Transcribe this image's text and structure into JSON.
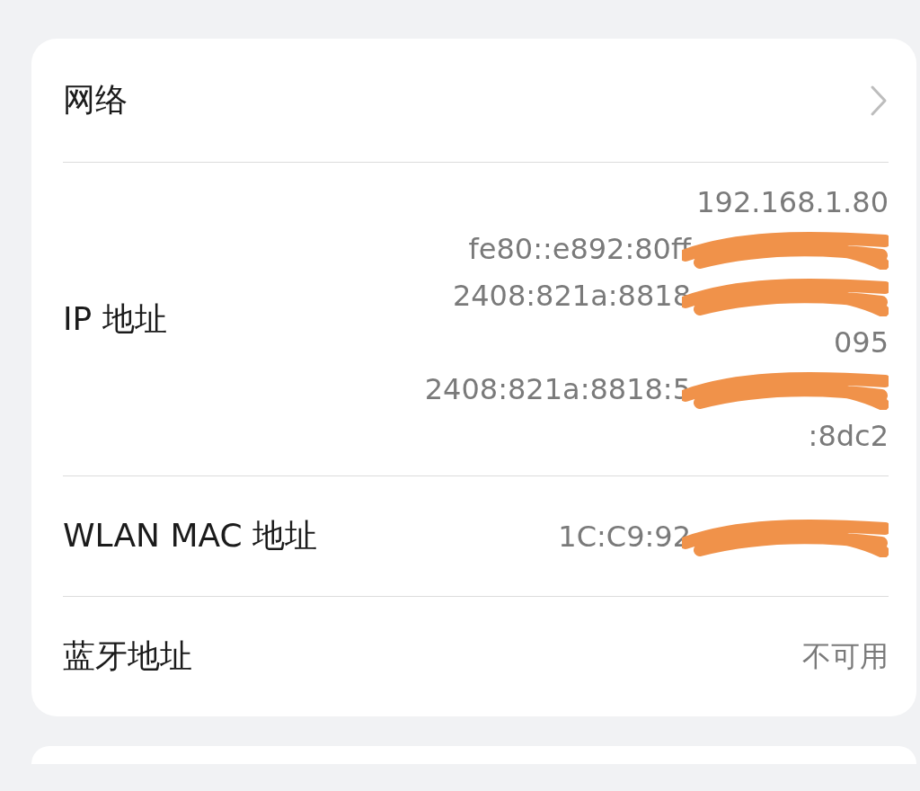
{
  "settings_card": [
    {
      "kind": "link",
      "label": "网络"
    },
    {
      "kind": "values",
      "label": "IP 地址",
      "values": [
        {
          "text": "192.168.1.80",
          "redacted": false
        },
        {
          "text": "fe80::e892:80ff",
          "redacted": true
        },
        {
          "text": "2408:821a:8818",
          "redacted": true
        },
        {
          "text": "095",
          "redacted": false
        },
        {
          "text": "2408:821a:8818:5",
          "redacted": true
        },
        {
          "text": ":8dc2",
          "redacted": false
        }
      ]
    },
    {
      "kind": "values",
      "label": "WLAN MAC 地址",
      "values": [
        {
          "text": "1C:C9:92",
          "redacted": true
        }
      ]
    },
    {
      "kind": "values",
      "label": "蓝牙地址",
      "values": [
        {
          "text": "不可用",
          "redacted": false
        }
      ]
    }
  ]
}
